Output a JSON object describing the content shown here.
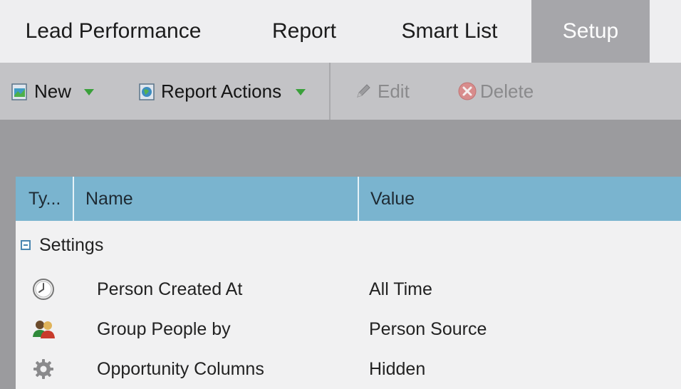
{
  "tabs": [
    {
      "label": "Lead Performance",
      "active": false
    },
    {
      "label": "Report",
      "active": false
    },
    {
      "label": "Smart List",
      "active": false
    },
    {
      "label": "Setup",
      "active": true
    }
  ],
  "toolbar": {
    "new_label": "New",
    "report_actions_label": "Report Actions",
    "edit_label": "Edit",
    "delete_label": "Delete"
  },
  "grid": {
    "columns": [
      "Ty...",
      "Name",
      "Value"
    ],
    "group_label": "Settings",
    "rows": [
      {
        "icon": "clock-icon",
        "name": "Person Created At",
        "value": "All Time"
      },
      {
        "icon": "people-icon",
        "name": "Group People by",
        "value": "Person Source"
      },
      {
        "icon": "gear-icon",
        "name": "Opportunity Columns",
        "value": "Hidden"
      }
    ]
  },
  "colors": {
    "tab_active": "#a6a6aa",
    "header_blue": "#7ab4cf",
    "caret_green": "#3aa03a"
  }
}
